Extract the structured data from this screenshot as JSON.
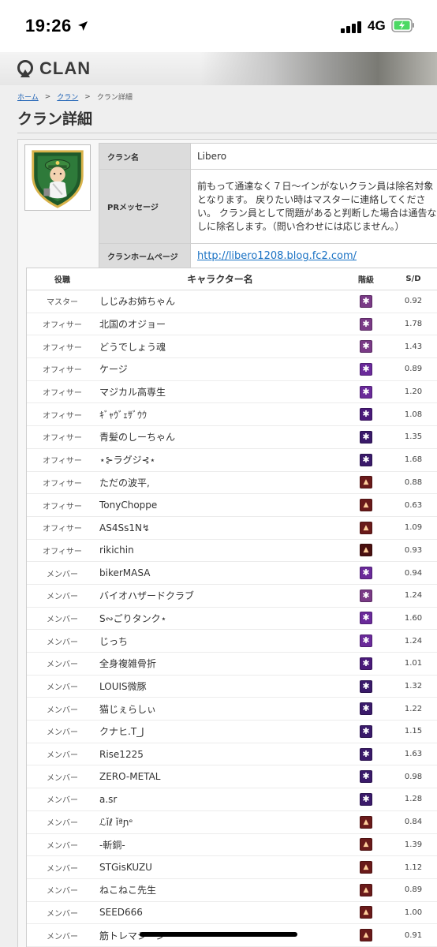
{
  "status_bar": {
    "time": "19:26",
    "network": "4G"
  },
  "header": {
    "logo_text": "CLAN"
  },
  "breadcrumb": [
    {
      "label": "ホーム",
      "link": true
    },
    {
      "label": ">",
      "link": false
    },
    {
      "label": "クラン",
      "link": true
    },
    {
      "label": ">",
      "link": false
    },
    {
      "label": "クラン詳細",
      "link": false
    }
  ],
  "page_title": "クラン詳細",
  "clan": {
    "name_label": "クラン名",
    "name": "Libero",
    "pr_label": "PRメッセージ",
    "pr_message": "前もって通達なく７日〜インがないクラン員は除名対象となります。 戻りたい時はマスターに連絡してください。 クラン員として問題があると判断した場合は通告なしに除名します。（問い合わせには応じません。）",
    "homepage_label": "クランホームページ",
    "homepage_url": "http://libero1208.blog.fc2.com/"
  },
  "members_table": {
    "headers": {
      "role": "役職",
      "name": "キャラクター名",
      "rank": "階級",
      "sd": "S/D"
    },
    "rows": [
      {
        "role": "マスター",
        "name": "しじみお姉ちゃん",
        "rank_color": "#7a3a86",
        "rank_shape": "star",
        "sd": "0.92"
      },
      {
        "role": "オフィサー",
        "name": "北国のオジョー",
        "rank_color": "#7a3a86",
        "rank_shape": "star",
        "sd": "1.78"
      },
      {
        "role": "オフィサー",
        "name": "どうでしょう魂",
        "rank_color": "#7a3a86",
        "rank_shape": "star",
        "sd": "1.43"
      },
      {
        "role": "オフィサー",
        "name": "ケージ",
        "rank_color": "#6a2a9a",
        "rank_shape": "star",
        "sd": "0.89"
      },
      {
        "role": "オフィサー",
        "name": "マジカル高専生",
        "rank_color": "#6a2a9a",
        "rank_shape": "star",
        "sd": "1.20"
      },
      {
        "role": "オフィサー",
        "name": "ｷﾞｬｳﾞｪｻﾞｳｳ",
        "rank_color": "#4a1a7a",
        "rank_shape": "star",
        "sd": "1.08"
      },
      {
        "role": "オフィサー",
        "name": "青髪のしーちゃん",
        "rank_color": "#3a1a6a",
        "rank_shape": "star",
        "sd": "1.35"
      },
      {
        "role": "オフィサー",
        "name": "⋆⊱ラグジ⊰⋆",
        "rank_color": "#3a1a6a",
        "rank_shape": "star",
        "sd": "1.68"
      },
      {
        "role": "オフィサー",
        "name": "ただの波平,",
        "rank_color": "#6a1a1a",
        "rank_shape": "flame",
        "sd": "0.88"
      },
      {
        "role": "オフィサー",
        "name": "TonyChoppe",
        "rank_color": "#6a1a1a",
        "rank_shape": "flame",
        "sd": "0.63"
      },
      {
        "role": "オフィサー",
        "name": "AS4Ss1N↯",
        "rank_color": "#6a1a1a",
        "rank_shape": "flame",
        "sd": "1.09"
      },
      {
        "role": "オフィサー",
        "name": "rikichin",
        "rank_color": "#4a1010",
        "rank_shape": "flame",
        "sd": "0.93"
      },
      {
        "role": "メンバー",
        "name": "bikerMASA",
        "rank_color": "#6a2a9a",
        "rank_shape": "star",
        "sd": "0.94"
      },
      {
        "role": "メンバー",
        "name": "バイオハザードクラブ",
        "rank_color": "#7a3a86",
        "rank_shape": "star",
        "sd": "1.24"
      },
      {
        "role": "メンバー",
        "name": "S∾ごりタンク⋆",
        "rank_color": "#6a2a9a",
        "rank_shape": "star",
        "sd": "1.60"
      },
      {
        "role": "メンバー",
        "name": "じっち",
        "rank_color": "#6a2a9a",
        "rank_shape": "star",
        "sd": "1.24"
      },
      {
        "role": "メンバー",
        "name": "全身複雑骨折",
        "rank_color": "#4a1a7a",
        "rank_shape": "star",
        "sd": "1.01"
      },
      {
        "role": "メンバー",
        "name": "LOUIS微豚",
        "rank_color": "#3a1a6a",
        "rank_shape": "star",
        "sd": "1.32"
      },
      {
        "role": "メンバー",
        "name": "猫じぇらしぃ",
        "rank_color": "#3a1a6a",
        "rank_shape": "star",
        "sd": "1.22"
      },
      {
        "role": "メンバー",
        "name": "クナヒ.T_J",
        "rank_color": "#3a1a6a",
        "rank_shape": "star",
        "sd": "1.15"
      },
      {
        "role": "メンバー",
        "name": "Rise1225",
        "rank_color": "#3a1a6a",
        "rank_shape": "star",
        "sd": "1.63"
      },
      {
        "role": "メンバー",
        "name": "ZERO-METAL",
        "rank_color": "#3a1a6a",
        "rank_shape": "star",
        "sd": "0.98"
      },
      {
        "role": "メンバー",
        "name": "a.sr",
        "rank_color": "#3a1a6a",
        "rank_shape": "star",
        "sd": "1.28"
      },
      {
        "role": "メンバー",
        "name": "ℒǐℓ ǐªɲᵉ",
        "rank_color": "#6a1a1a",
        "rank_shape": "flame",
        "sd": "0.84"
      },
      {
        "role": "メンバー",
        "name": "-斬銅-",
        "rank_color": "#6a1a1a",
        "rank_shape": "flame",
        "sd": "1.39"
      },
      {
        "role": "メンバー",
        "name": "STGisKUZU",
        "rank_color": "#6a1a1a",
        "rank_shape": "flame",
        "sd": "1.12"
      },
      {
        "role": "メンバー",
        "name": "ねこねこ先生",
        "rank_color": "#6a1a1a",
        "rank_shape": "flame",
        "sd": "0.89"
      },
      {
        "role": "メンバー",
        "name": "SEED666",
        "rank_color": "#6a1a1a",
        "rank_shape": "flame",
        "sd": "1.00"
      },
      {
        "role": "メンバー",
        "name": "筋トレマシーン",
        "rank_color": "#6a1a1a",
        "rank_shape": "flame",
        "sd": "0.91"
      }
    ]
  }
}
